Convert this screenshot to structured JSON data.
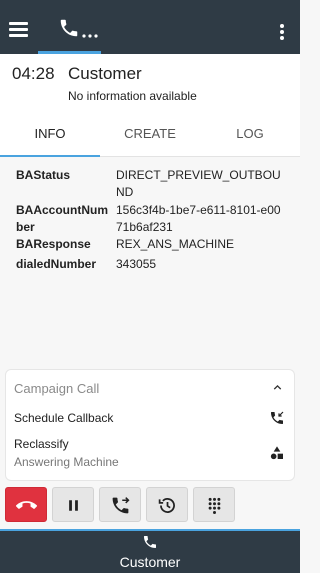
{
  "topbar": {
    "menu_icon": "menu-icon",
    "call_tab_icon": "phone-icon",
    "call_tab_suffix": "...",
    "more_icon": "more-vert-icon",
    "bg_color": "#2f3b45",
    "accent_color": "#4aa3df"
  },
  "call": {
    "timer": "04:28",
    "caller": "Customer",
    "subtitle": "No information available"
  },
  "tabs": [
    {
      "label": "INFO",
      "active": true
    },
    {
      "label": "CREATE",
      "active": false
    },
    {
      "label": "LOG",
      "active": false
    }
  ],
  "info": [
    {
      "key": "BAStatus",
      "value": "DIRECT_PREVIEW_OUTBOUND"
    },
    {
      "key": "BAAccountNumber",
      "value": "156c3f4b-1be7-e611-8101-e0071b6af231"
    },
    {
      "key": "BAResponse",
      "value": "REX_ANS_MACHINE"
    },
    {
      "key": "dialedNumber",
      "value": "343055"
    }
  ],
  "campaign": {
    "title": "Campaign Call",
    "collapse_icon": "chevron-up-icon",
    "schedule_label": "Schedule Callback",
    "schedule_icon": "callback-icon",
    "reclassify_label": "Reclassify",
    "reclassify_value": "Answering Machine",
    "reclassify_icon": "shapes-icon"
  },
  "actions": [
    {
      "name": "end-call-button",
      "icon": "hangup-icon",
      "color": "#e0323f"
    },
    {
      "name": "hold-button",
      "icon": "pause-icon"
    },
    {
      "name": "transfer-button",
      "icon": "call-transfer-icon"
    },
    {
      "name": "history-button",
      "icon": "history-icon"
    },
    {
      "name": "dialpad-button",
      "icon": "dialpad-icon"
    }
  ],
  "bottom": {
    "label": "Customer",
    "icon": "phone-icon"
  }
}
